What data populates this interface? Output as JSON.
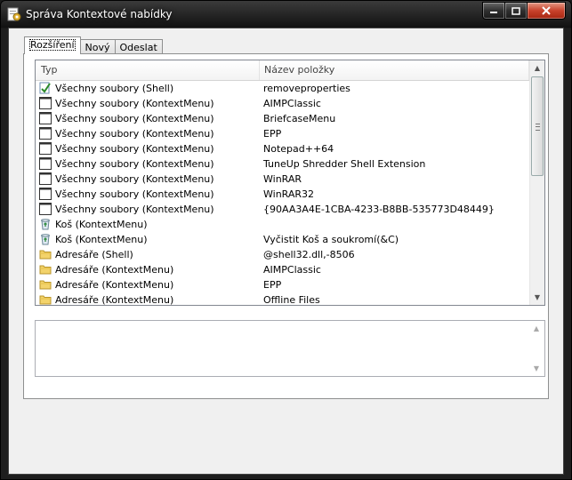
{
  "window": {
    "title": "Správa Kontextové nabídky"
  },
  "tabs": [
    {
      "label": "Rozšíření",
      "active": true
    },
    {
      "label": "Nový",
      "active": false
    },
    {
      "label": "Odeslat",
      "active": false
    }
  ],
  "list": {
    "columns": [
      "Typ",
      "Název položky"
    ],
    "rows": [
      {
        "type": "Všechny soubory (Shell)",
        "name": "removeproperties",
        "icon": "shell-check-icon"
      },
      {
        "type": "Všechny soubory (KontextMenu)",
        "name": "AIMPClassic",
        "icon": "window-icon"
      },
      {
        "type": "Všechny soubory (KontextMenu)",
        "name": "BriefcaseMenu",
        "icon": "window-icon"
      },
      {
        "type": "Všechny soubory (KontextMenu)",
        "name": "EPP",
        "icon": "window-icon"
      },
      {
        "type": "Všechny soubory (KontextMenu)",
        "name": "Notepad++64",
        "icon": "window-icon"
      },
      {
        "type": "Všechny soubory (KontextMenu)",
        "name": "TuneUp Shredder Shell Extension",
        "icon": "window-icon"
      },
      {
        "type": "Všechny soubory (KontextMenu)",
        "name": "WinRAR",
        "icon": "window-icon"
      },
      {
        "type": "Všechny soubory (KontextMenu)",
        "name": "WinRAR32",
        "icon": "window-icon"
      },
      {
        "type": "Všechny soubory (KontextMenu)",
        "name": "{90AA3A4E-1CBA-4233-B8BB-535773D48449}",
        "icon": "window-icon"
      },
      {
        "type": "Koš (KontextMenu)",
        "name": "",
        "icon": "recycle-bin-icon"
      },
      {
        "type": "Koš (KontextMenu)",
        "name": "Vyčistit Koš a soukromí(&C)",
        "icon": "recycle-bin-icon"
      },
      {
        "type": "Adresáře (Shell)",
        "name": "@shell32.dll,-8506",
        "icon": "folder-icon"
      },
      {
        "type": "Adresáře (KontextMenu)",
        "name": "AIMPClassic",
        "icon": "folder-icon"
      },
      {
        "type": "Adresáře (KontextMenu)",
        "name": "EPP",
        "icon": "folder-icon"
      },
      {
        "type": "Adresáře (KontextMenu)",
        "name": "Offline Files",
        "icon": "folder-icon"
      }
    ]
  },
  "description": {
    "text": ""
  }
}
